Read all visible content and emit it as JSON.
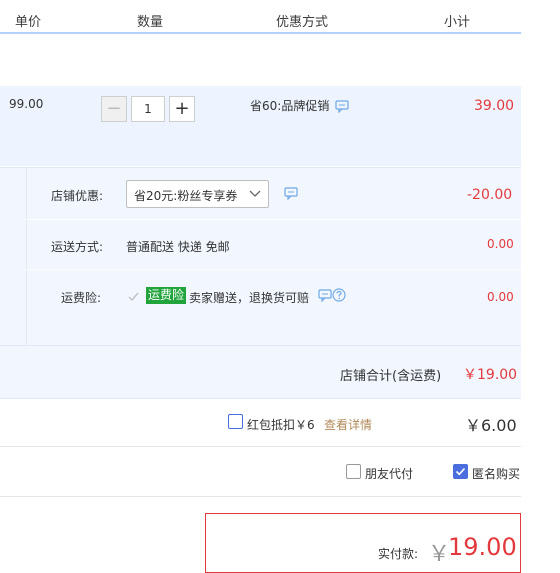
{
  "header": {
    "col_price": "单价",
    "col_qty": "数量",
    "col_discount": "优惠方式",
    "col_subtotal": "小计"
  },
  "item": {
    "price": "99.00",
    "qty_minus": "−",
    "qty_value": "1",
    "qty_plus": "+",
    "promo": "省60:品牌促销",
    "subtotal": "39.00"
  },
  "shop": {
    "discount_label": "店铺优惠:",
    "discount_select": "省20元:粉丝专享券",
    "discount_amount": "-20.00",
    "shipping_label": "运送方式:",
    "shipping_value": "普通配送 快递 免邮",
    "shipping_amount": "0.00",
    "insurance_label": "运费险:",
    "insurance_badge": "运费险",
    "insurance_text": "卖家赠送，退换货可赔",
    "insurance_amount": "0.00",
    "total_label": "店铺合计(含运费)",
    "total_amount": "￥19.00"
  },
  "redpacket": {
    "label": "红包抵扣￥6",
    "link": "查看详情",
    "amount": "￥6.00"
  },
  "options": {
    "friend_pay": "朋友代付",
    "anonymous": "匿名购买",
    "anonymous_checked": true,
    "friend_checked": false
  },
  "payment": {
    "label": "实付款:",
    "currency": "￥",
    "amount": "19.00"
  },
  "colors": {
    "accent_red": "#e4393c",
    "accent_blue": "#4b6ede",
    "badge_green": "#22a43d",
    "link_orange": "#b08a5a"
  }
}
